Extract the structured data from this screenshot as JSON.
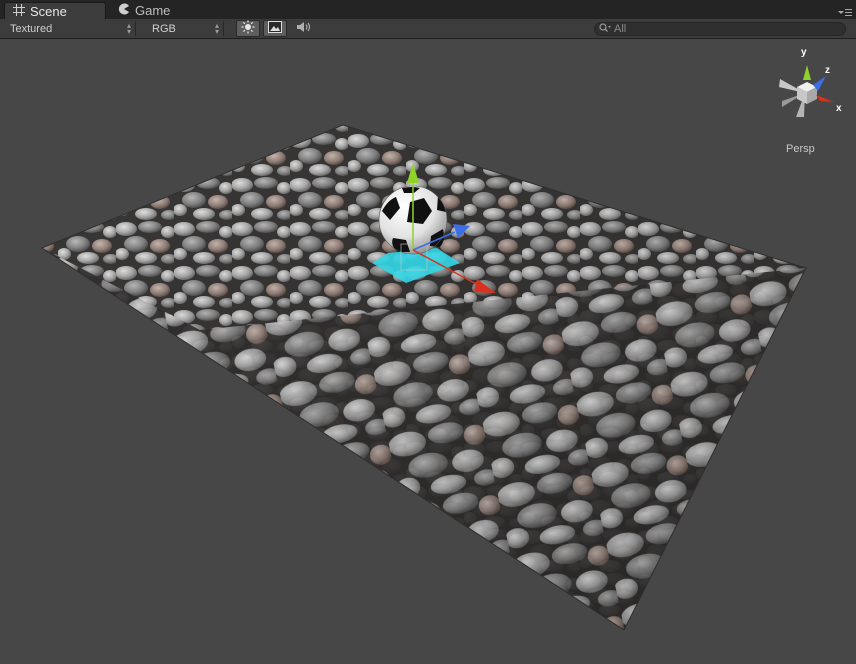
{
  "tabs": [
    {
      "label": "Scene",
      "icon": "scene-grid-icon",
      "active": true
    },
    {
      "label": "Game",
      "icon": "game-pacman-icon",
      "active": false
    }
  ],
  "toolbar": {
    "draw_mode": "Textured",
    "render_mode": "RGB",
    "lighting_icon": "sun-icon",
    "overlay_icon": "image-icon",
    "audio_icon": "speaker-icon",
    "search_placeholder": "All"
  },
  "scene_gizmo": {
    "axis_labels": {
      "x": "x",
      "y": "y",
      "z": "z"
    },
    "projection": "Persp",
    "colors": {
      "x": "#d8321e",
      "y": "#8fd22a",
      "z": "#3c6fe6"
    }
  },
  "scene_objects": [
    {
      "name": "Soccer ball",
      "selected": true
    },
    {
      "name": "Gravel ground plane",
      "selected": false
    }
  ],
  "colors": {
    "viewport_bg": "#474747",
    "selection_cyan": "#33d6e6"
  }
}
